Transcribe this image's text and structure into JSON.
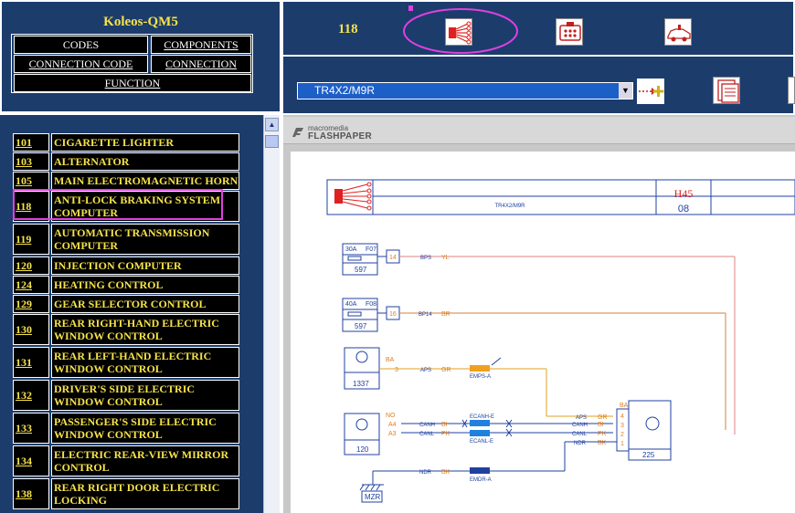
{
  "app": {
    "title": "Koleos-QM5"
  },
  "nav": {
    "codes": "CODES",
    "components": "COMPONENTS",
    "connection_code": "CONNECTION CODE",
    "connection": "CONNECTION",
    "function": "FUNCTION"
  },
  "toolbar": {
    "item_number": "118",
    "variant": "TR4X2/M9R"
  },
  "viewer": {
    "logo_line1": "macromedia",
    "logo_line2": "FLASHPAPER"
  },
  "components": [
    {
      "code": "101",
      "label": "CIGARETTE LIGHTER"
    },
    {
      "code": "103",
      "label": "ALTERNATOR"
    },
    {
      "code": "105",
      "label": "MAIN ELECTROMAGNETIC HORN"
    },
    {
      "code": "118",
      "label": "ANTI-LOCK BRAKING SYSTEM COMPUTER"
    },
    {
      "code": "119",
      "label": "AUTOMATIC TRANSMISSION COMPUTER"
    },
    {
      "code": "120",
      "label": "INJECTION COMPUTER"
    },
    {
      "code": "124",
      "label": "HEATING CONTROL"
    },
    {
      "code": "129",
      "label": "GEAR SELECTOR CONTROL"
    },
    {
      "code": "130",
      "label": "REAR RIGHT-HAND ELECTRIC WINDOW CONTROL"
    },
    {
      "code": "131",
      "label": "REAR LEFT-HAND ELECTRIC WINDOW CONTROL"
    },
    {
      "code": "132",
      "label": "DRIVER'S SIDE ELECTRIC WINDOW CONTROL"
    },
    {
      "code": "133",
      "label": "PASSENGER'S SIDE ELECTRIC WINDOW CONTROL"
    },
    {
      "code": "134",
      "label": "ELECTRIC REAR-VIEW MIRROR CONTROL"
    },
    {
      "code": "138",
      "label": "REAR RIGHT DOOR ELECTRIC LOCKING"
    }
  ],
  "diagram": {
    "header_text": "TR4X2/M9R",
    "header_code": "H45",
    "header_sub": "08",
    "fuse1_rating": "30A",
    "fuse1_code": "F07",
    "fuse1_box": "597",
    "fuse1_pin": "14",
    "wire1_code": "BPS",
    "wire1_color": "YL",
    "fuse2_rating": "40A",
    "fuse2_code": "F08",
    "fuse2_box": "597",
    "fuse2_pin": "16",
    "wire2_code": "BP14",
    "wire2_color": "BR",
    "sensor1_pin": "BA",
    "sensor1_pinno": "3",
    "sensor1_box": "1337",
    "wire3_code": "APS",
    "wire3_color": "GR",
    "conn3_code": "EMPS-A",
    "sensor2_pin": "NO",
    "sensor2_a4": "A4",
    "sensor2_a3": "A3",
    "sensor2_box": "120",
    "can_h": "CANH",
    "can_l": "CANL",
    "can_h_color": "BI",
    "can_l_color": "PK",
    "conn_canh": "ECANH-E",
    "conn_canl": "ECANL-E",
    "ecu_box": "225",
    "ecu_pin_ba": "BA",
    "ecu_pins": [
      "4",
      "3",
      "2",
      "1"
    ],
    "ecu_wire_codes": [
      "APS",
      "CANH",
      "CANL",
      "NDR"
    ],
    "ecu_wire_colors": [
      "GR",
      "BI",
      "PK",
      "BK"
    ],
    "ground_wire": "NDR",
    "ground_color": "BK",
    "ground_conn": "EMDR-A",
    "ground_label": "MZR"
  }
}
